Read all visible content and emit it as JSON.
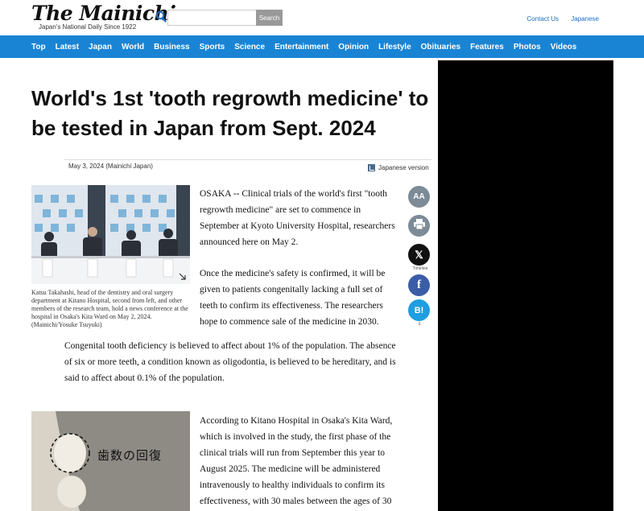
{
  "header": {
    "logo": "The Mainichi",
    "tagline": "Japan's National Daily Since 1922",
    "search_placeholder": "",
    "search_button": "Search",
    "links": [
      "Contact Us",
      "Japanese"
    ]
  },
  "nav": {
    "items": [
      "Top",
      "Latest",
      "Japan",
      "World",
      "Business",
      "Sports",
      "Science",
      "Entertainment",
      "Opinion",
      "Lifestyle",
      "Obituaries",
      "Features",
      "Photos",
      "Videos"
    ]
  },
  "article": {
    "headline": "World's 1st 'tooth regrowth medicine' to be tested in Japan from Sept. 2024",
    "dateline": "May 3, 2024 (Mainichi Japan)",
    "japanese_version": "Japanese version",
    "photo1_caption": "Katsu Takahashi, head of the dentistry and oral surgery department at Kitano Hospital, second from left, and other members of the research team, hold a news conference at the hospital in Osaka's Kita Ward on May 2, 2024. (Mainichi/Yosuke Tsuyuki)",
    "paragraphs": [
      "OSAKA -- Clinical trials of the world's first \"tooth regrowth medicine\" are set to commence in September at Kyoto University Hospital, researchers announced here on May 2.",
      "Once the medicine's safety is confirmed, it will be given to patients congenitally lacking a full set of teeth to confirm its effectiveness. The researchers hope to commence sale of the medicine in 2030.",
      "Congenital tooth deficiency is believed to affect about 1% of the population. The absence of six or more teeth, a condition known as oligodontia, is believed to be hereditary, and is said to affect about 0.1% of the population.",
      "According to Kitano Hospital in Osaka's Kita Ward, which is involved in the study, the first phase of the clinical trials will run from September this year to August 2025. The medicine will be administered intravenously to healthy individuals to confirm its effectiveness, with 30 males between the ages of 30"
    ],
    "photo2_text": "歯数の回復"
  },
  "social": {
    "font_label": "AA",
    "x_label": "Timeline",
    "hatena_label": "B!",
    "hatena_count": "0"
  }
}
